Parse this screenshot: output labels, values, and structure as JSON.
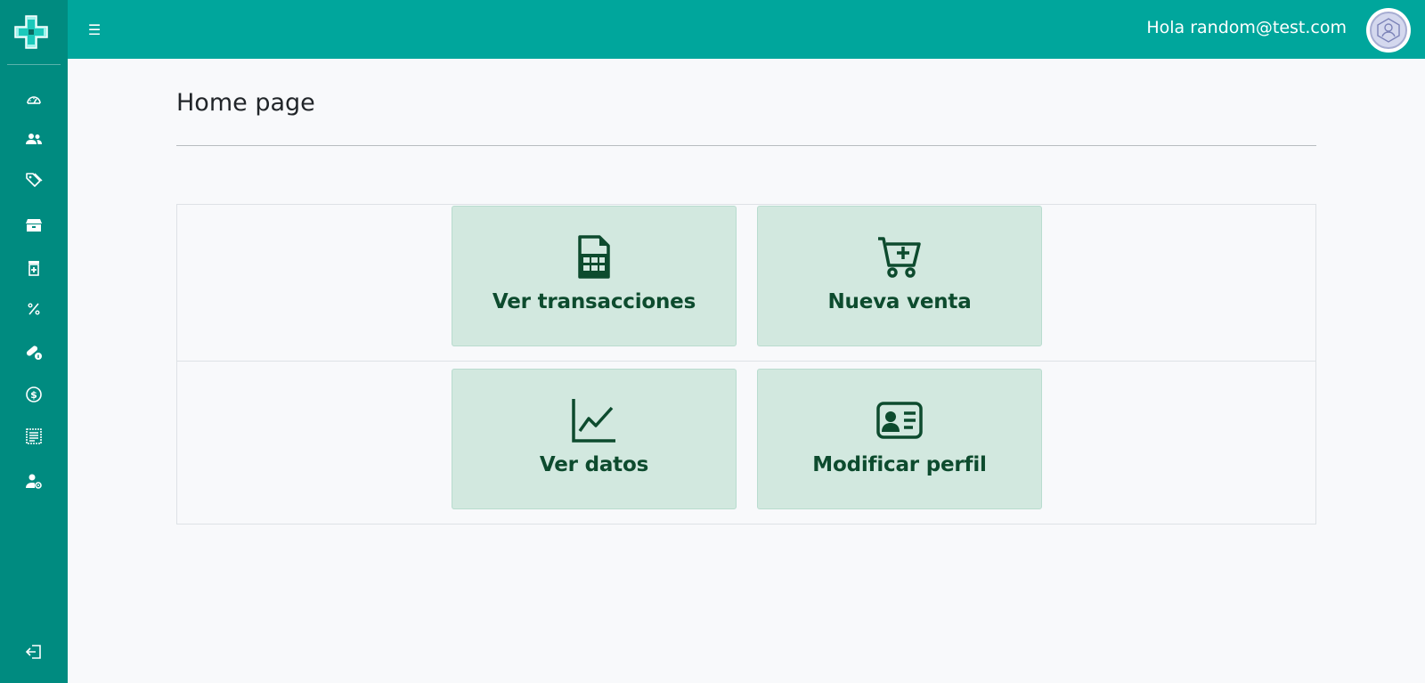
{
  "header": {
    "greeting": "Hola random@test.com"
  },
  "sidebar": {
    "items": [
      {
        "icon": "dashboard-icon"
      },
      {
        "icon": "users-icon"
      },
      {
        "icon": "tags-icon"
      },
      {
        "icon": "inventory-icon"
      },
      {
        "icon": "pharmacy-icon"
      },
      {
        "icon": "percent-icon"
      },
      {
        "icon": "pills-info-icon"
      },
      {
        "icon": "dollar-icon"
      },
      {
        "icon": "receipt-icon"
      },
      {
        "icon": "user-settings-icon"
      }
    ],
    "logout_icon": "logout-icon"
  },
  "main": {
    "title": "Home page",
    "cards": [
      {
        "label": "Ver transacciones",
        "icon": "spreadsheet-icon"
      },
      {
        "label": "Nueva venta",
        "icon": "cart-plus-icon"
      },
      {
        "label": "Ver datos",
        "icon": "graph-icon"
      },
      {
        "label": "Modificar perfil",
        "icon": "id-card-icon"
      }
    ]
  },
  "colors": {
    "sidebar": "#008b80",
    "topbar": "#00a69c",
    "card_bg": "#d2e8df",
    "card_text": "#0d4b2e"
  }
}
